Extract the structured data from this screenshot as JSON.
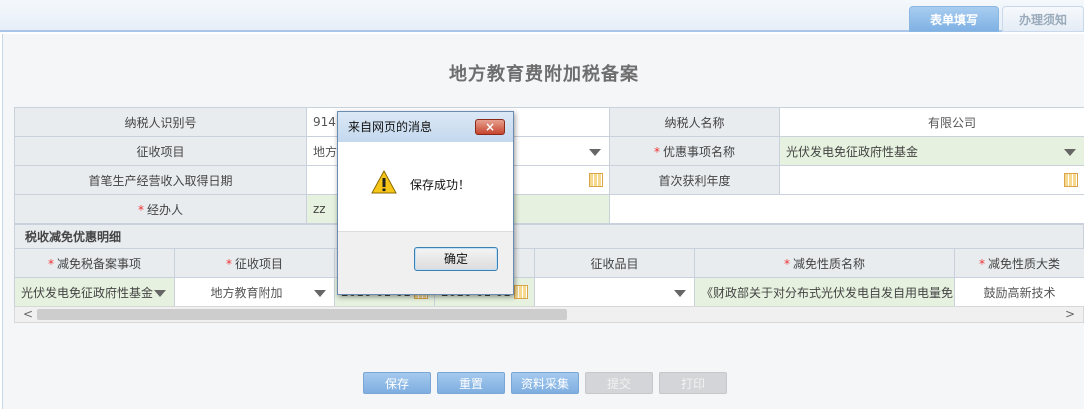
{
  "tabs": {
    "active": "表单填写",
    "inactive": "办理须知"
  },
  "page": {
    "title": "地方教育费附加税备案"
  },
  "basic_info": {
    "taxpayer_id_label": "纳税人识别号",
    "taxpayer_id_value": "914",
    "taxpayer_name_label": "纳税人名称",
    "taxpayer_name_value": "有限公司",
    "collection_item_label": "征收项目",
    "collection_item_value": "地方",
    "preferential_item_label": "优惠事项名称",
    "preferential_item_value": "光伏发电免征政府性基金",
    "first_income_date_label": "首笔生产经营收入取得日期",
    "first_profit_year_label": "首次获利年度",
    "handler_label": "经办人",
    "handler_value": "zz"
  },
  "detail": {
    "section_title": "税收减免优惠明细",
    "headers": [
      "减免税备案事项",
      "征收项目",
      "征收品目",
      "减免性质名称",
      "减免性质大类"
    ],
    "row": {
      "filing_item": "光伏发电免征政府性基金",
      "collection_item": "地方教育附加",
      "date_start": "2016-01-01",
      "date_end": "2016-01-01",
      "collection_product": "",
      "reduction_name": "《财政部关于对分布式光伏发电自发自用电量免",
      "reduction_category": "鼓励高新技术"
    }
  },
  "scrollbar": {
    "left_arrow": "<",
    "right_arrow": ">"
  },
  "buttons": {
    "save": "保存",
    "reset": "重置",
    "collect": "资料采集",
    "submit": "提交",
    "print": "打印"
  },
  "dialog": {
    "title": "来自网页的消息",
    "close": "×",
    "message": "保存成功！",
    "ok": "确定"
  },
  "colors": {
    "accent": "#7fb1e4",
    "required": "#e33333",
    "green_field": "#e6f2df"
  }
}
